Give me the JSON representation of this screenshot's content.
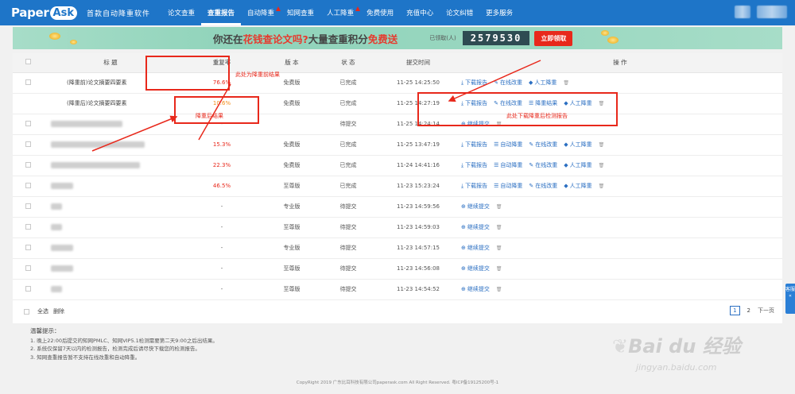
{
  "nav": {
    "logo_main": "Paper",
    "logo_badge": "Ask",
    "slogan": "首款自动降重软件",
    "items": [
      {
        "label": "论文查重",
        "hot": false,
        "active": false
      },
      {
        "label": "查重报告",
        "hot": false,
        "active": true
      },
      {
        "label": "自动降重",
        "hot": true,
        "active": false
      },
      {
        "label": "知网查重",
        "hot": false,
        "active": false
      },
      {
        "label": "人工降重",
        "hot": true,
        "active": false
      },
      {
        "label": "免费使用",
        "hot": false,
        "active": false
      },
      {
        "label": "充值中心",
        "hot": false,
        "active": false
      },
      {
        "label": "论文纠错",
        "hot": false,
        "active": false
      },
      {
        "label": "更多服务",
        "hot": false,
        "active": false
      }
    ]
  },
  "banner": {
    "text_a": "你还在",
    "text_b": "花钱查论文吗?",
    "text_c": "大量查重积分",
    "text_d": "免费送",
    "claimed_label": "已领取(人)",
    "claimed_count": "2579530",
    "claim_button": "立即领取"
  },
  "table": {
    "headers": [
      "",
      "标 题",
      "重复率",
      "版 本",
      "状 态",
      "提交时间",
      "操 作"
    ],
    "rows": [
      {
        "title": "(降重前)论文摘要四要素",
        "blur": 0,
        "rate": "76.6%",
        "rate_style": "red",
        "version": "免费版",
        "status": "已完成",
        "time": "11-25 14:25:50",
        "ops": [
          "download",
          "online_edit",
          "manual"
        ]
      },
      {
        "title": "(降重后)论文摘要四要素",
        "blur": 0,
        "rate": "10.6%",
        "rate_style": "orange",
        "version": "免费版",
        "status": "已完成",
        "time": "11-25 14:27:19",
        "ops": [
          "download",
          "online_edit",
          "reduce_result",
          "manual"
        ]
      },
      {
        "title": "",
        "blur": 90,
        "rate": "-",
        "rate_style": "",
        "version": "",
        "status": "待提交",
        "time": "11-25 14:24:14",
        "ops": [
          "continue"
        ]
      },
      {
        "title": "",
        "blur": 118,
        "rate": "15.3%",
        "rate_style": "red",
        "version": "免费版",
        "status": "已完成",
        "time": "11-25 13:47:19",
        "ops": [
          "download",
          "auto_reduce",
          "online_edit",
          "manual"
        ]
      },
      {
        "title": "",
        "blur": 112,
        "rate": "22.3%",
        "rate_style": "red",
        "version": "免费版",
        "status": "已完成",
        "time": "11-24 14:41:16",
        "ops": [
          "download",
          "auto_reduce",
          "online_edit",
          "manual"
        ]
      },
      {
        "title": "",
        "blur": 28,
        "rate": "46.5%",
        "rate_style": "red",
        "version": "至尊版",
        "status": "已完成",
        "time": "11-23 15:23:24",
        "ops": [
          "download",
          "auto_reduce",
          "online_edit",
          "manual"
        ]
      },
      {
        "title": "",
        "blur": 14,
        "rate": "-",
        "rate_style": "",
        "version": "专业版",
        "status": "待提交",
        "time": "11-23 14:59:56",
        "ops": [
          "continue"
        ]
      },
      {
        "title": "",
        "blur": 14,
        "rate": "-",
        "rate_style": "",
        "version": "至尊版",
        "status": "待提交",
        "time": "11-23 14:59:03",
        "ops": [
          "continue"
        ]
      },
      {
        "title": "",
        "blur": 28,
        "rate": "-",
        "rate_style": "",
        "version": "专业版",
        "status": "待提交",
        "time": "11-23 14:57:15",
        "ops": [
          "continue"
        ]
      },
      {
        "title": "",
        "blur": 28,
        "rate": "-",
        "rate_style": "",
        "version": "至尊版",
        "status": "待提交",
        "time": "11-23 14:56:08",
        "ops": [
          "continue"
        ]
      },
      {
        "title": "",
        "blur": 14,
        "rate": "-",
        "rate_style": "",
        "version": "至尊版",
        "status": "待提交",
        "time": "11-23 14:54:52",
        "ops": [
          "continue"
        ]
      }
    ],
    "op_labels": {
      "download": "下载报告",
      "online_edit": "在线改重",
      "reduce_result": "降重结果",
      "auto_reduce": "自动降重",
      "manual": "人工降重",
      "continue": "继续提交"
    },
    "icons": {
      "download": "download-icon",
      "online_edit": "pencil-icon",
      "reduce_result": "list-icon",
      "auto_reduce": "list-icon",
      "manual": "graduation-cap-icon",
      "continue": "arrow-up-circle-icon",
      "delete": "trash-icon"
    }
  },
  "bottom": {
    "select_all": "全选",
    "delete": "删除",
    "pages": [
      "1",
      "2"
    ],
    "current_page": "1",
    "next": "下一页"
  },
  "tips": {
    "title": "温馨提示：",
    "lines": [
      "1. 晚上22:00后提交的知网PMLC、知网VIP5.1检测需要第二天9:00之后出结果。",
      "2. 系统仅保留7天以内的检测报告，检测完成后请尽快下载您的检测报告。",
      "3. 知网查重报告暂不支持在线改重和自动降重。"
    ]
  },
  "copyright": "CopyRight 2019 广东比耳科技有限公司paperask.com All Right Reserved. 粤ICP备19125200号-1",
  "annotations": {
    "before": "此处为降重前结果",
    "after": "降重后结果",
    "download_hint": "此处下载降重后检测报告"
  },
  "side_tab": "客服",
  "watermark": {
    "brand": "Bai du 经验",
    "url": "jingyan.baidu.com"
  },
  "colors": {
    "nav": "#1e75c8",
    "accent_red": "#e8281b",
    "link": "#2b6fc2",
    "orange": "#f28c1a"
  }
}
